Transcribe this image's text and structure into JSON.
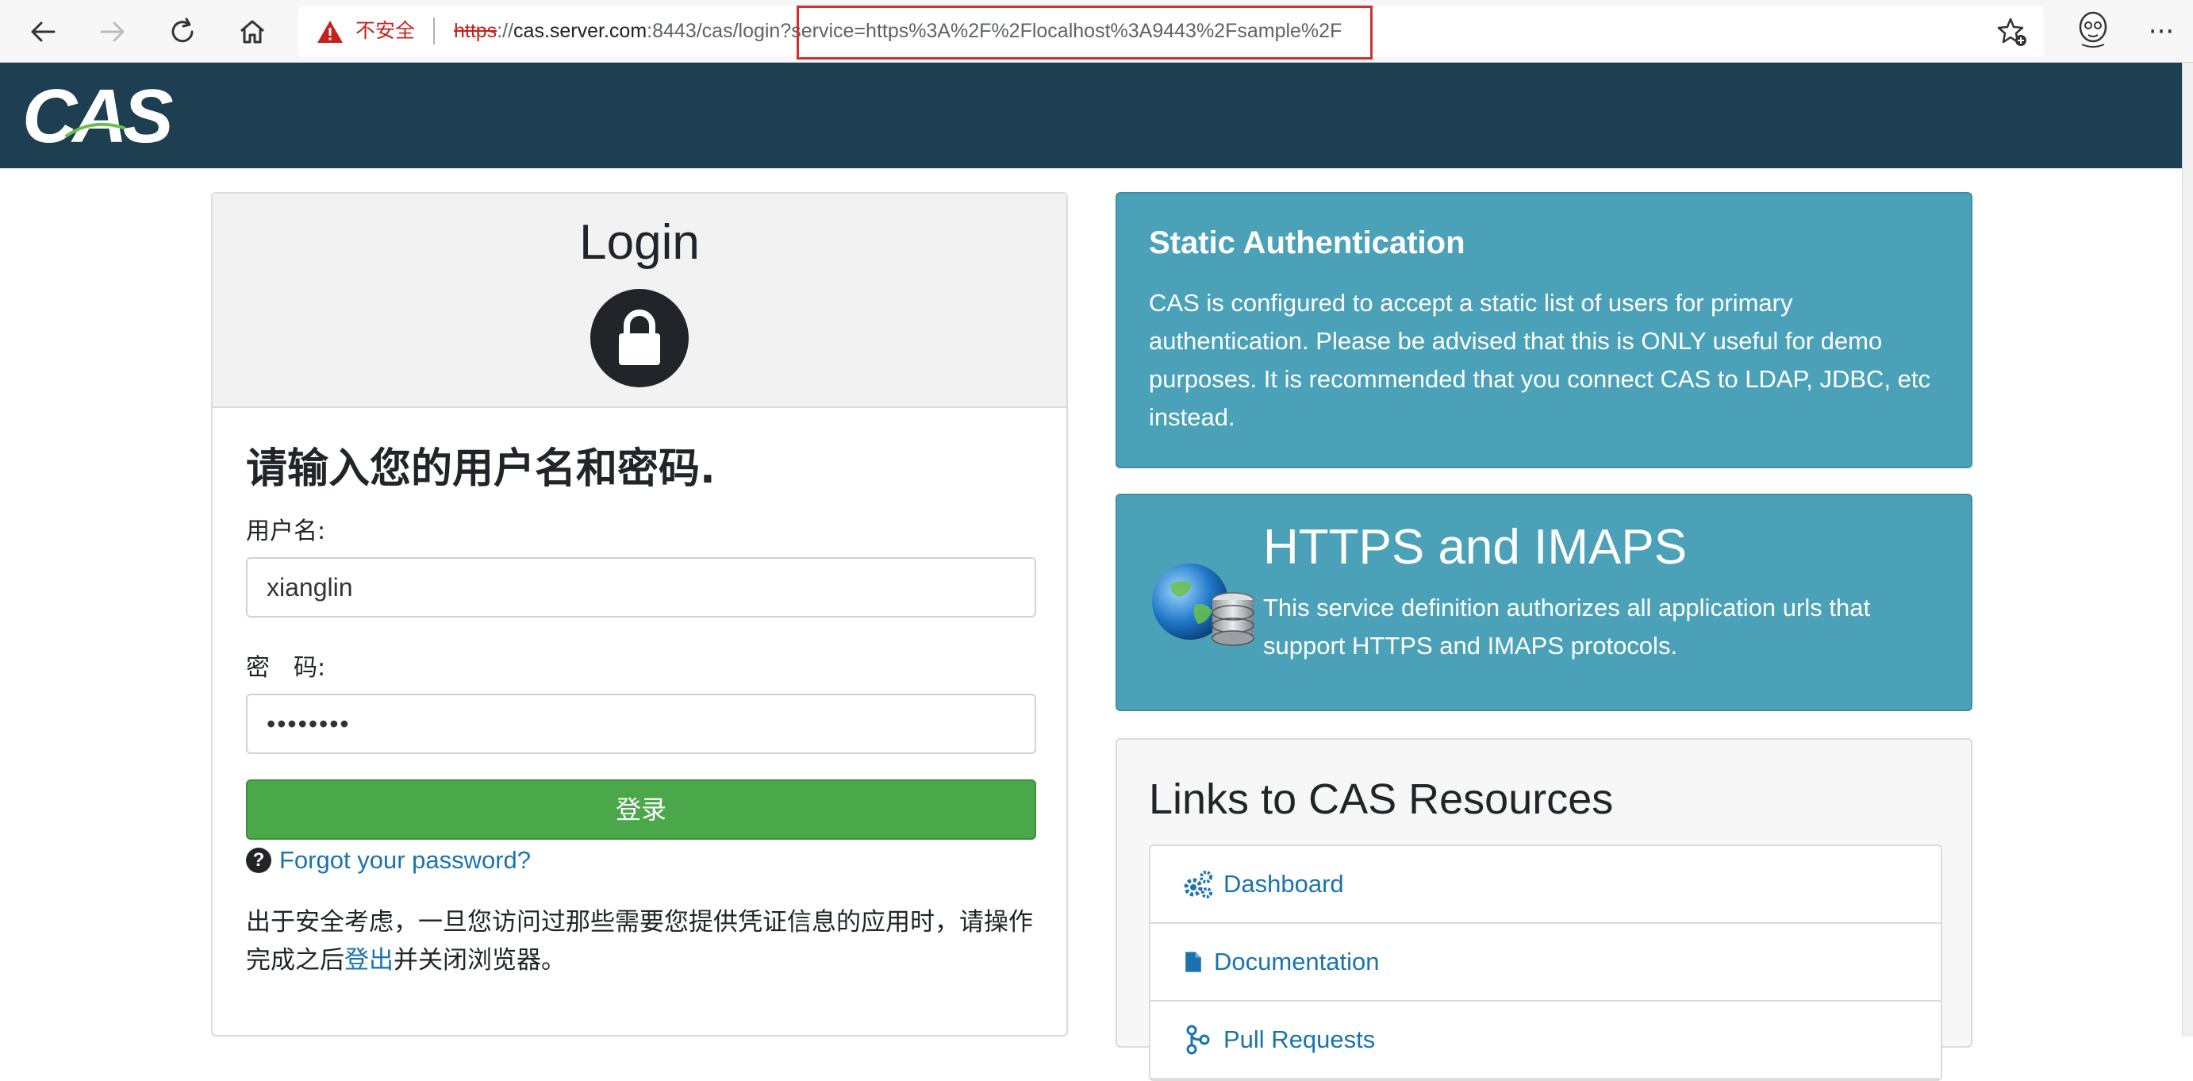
{
  "browser": {
    "insecure_label": "不安全",
    "url_protocol": "https",
    "url_sep": "://",
    "url_host": "cas.server.com",
    "url_path": ":8443/cas/login",
    "url_query": "?service=https%3A%2F%2Flocalhost%3A9443%2Fsample%2F",
    "more_label": "···"
  },
  "header": {
    "logo_text": "CAS"
  },
  "login": {
    "title": "Login",
    "prompt": "请输入您的用户名和密码.",
    "username_label": "用户名:",
    "username_value": "xianglin",
    "password_label": "密　码:",
    "password_value": "••••••••",
    "submit_label": "登录",
    "forgot_link": "Forgot your password?",
    "security_note_before": "出于安全考虑，一旦您访问过那些需要您提供凭证信息的应用时，请操作完成之后",
    "security_note_link": "登出",
    "security_note_after": "并关闭浏览器。"
  },
  "static_auth": {
    "title": "Static Authentication",
    "body": "CAS is configured to accept a static list of users for primary authentication. Please be advised that this is ONLY useful for demo purposes. It is recommended that you connect CAS to LDAP, JDBC, etc instead."
  },
  "https_imaps": {
    "title": "HTTPS and IMAPS",
    "body": "This service definition authorizes all application urls that support HTTPS and IMAPS protocols."
  },
  "resources": {
    "title": "Links to CAS Resources",
    "items": [
      {
        "label": "Dashboard",
        "icon": "gears-icon"
      },
      {
        "label": "Documentation",
        "icon": "document-icon"
      },
      {
        "label": "Pull Requests",
        "icon": "merge-icon"
      }
    ]
  },
  "colors": {
    "header_bg": "#1e3f52",
    "info_card_bg": "#4ba2b8",
    "login_button_bg": "#4aa84a",
    "link_color": "#1a73b0",
    "insecure_red": "#c5221f"
  }
}
